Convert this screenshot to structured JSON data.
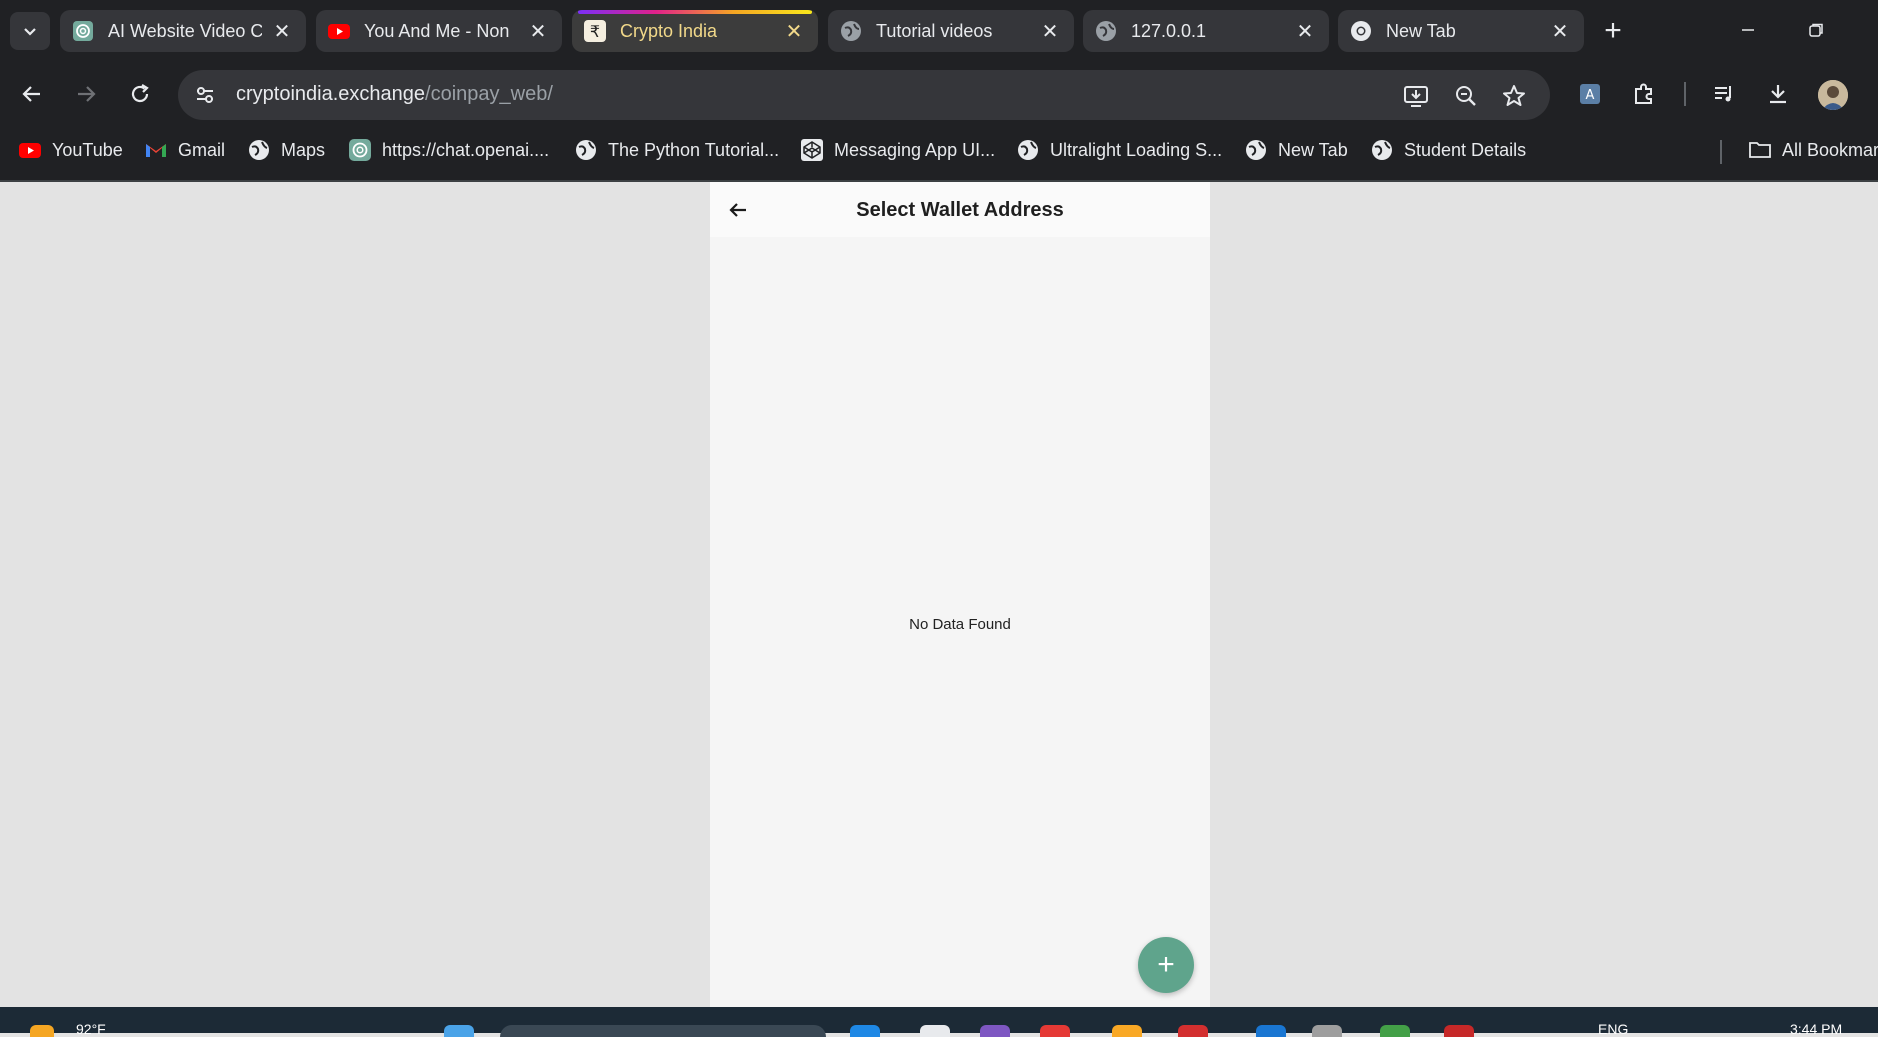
{
  "tabs": [
    {
      "title": "AI Website Video C",
      "icon": "chatgpt-icon",
      "active": false
    },
    {
      "title": "You And Me - Non",
      "icon": "youtube-icon",
      "active": false
    },
    {
      "title": "Crypto India",
      "icon": "rupee-icon",
      "active": true
    },
    {
      "title": "Tutorial videos",
      "icon": "globe-icon",
      "active": false
    },
    {
      "title": "127.0.0.1",
      "icon": "globe-icon",
      "active": false
    },
    {
      "title": "New Tab",
      "icon": "chrome-icon",
      "active": false
    }
  ],
  "address_bar": {
    "domain": "cryptoindia.exchange",
    "path": "/coinpay_web/"
  },
  "bookmarks": [
    {
      "label": "YouTube",
      "icon": "youtube-icon"
    },
    {
      "label": "Gmail",
      "icon": "gmail-icon"
    },
    {
      "label": "Maps",
      "icon": "globe-icon"
    },
    {
      "label": "https://chat.openai....",
      "icon": "chatgpt-icon"
    },
    {
      "label": "The Python Tutorial...",
      "icon": "globe-icon"
    },
    {
      "label": "Messaging App UI...",
      "icon": "codepen-icon"
    },
    {
      "label": "Ultralight Loading S...",
      "icon": "globe-icon"
    },
    {
      "label": "New Tab",
      "icon": "globe-icon"
    },
    {
      "label": "Student Details",
      "icon": "globe-icon"
    }
  ],
  "all_bookmarks_label": "All Bookmarks",
  "app": {
    "title": "Select Wallet Address",
    "empty_message": "No Data Found",
    "fab_label": "+",
    "accent_color": "#5fa48c"
  },
  "taskbar": {
    "weather": "92°F",
    "language": "ENG",
    "time": "3:44 PM"
  }
}
